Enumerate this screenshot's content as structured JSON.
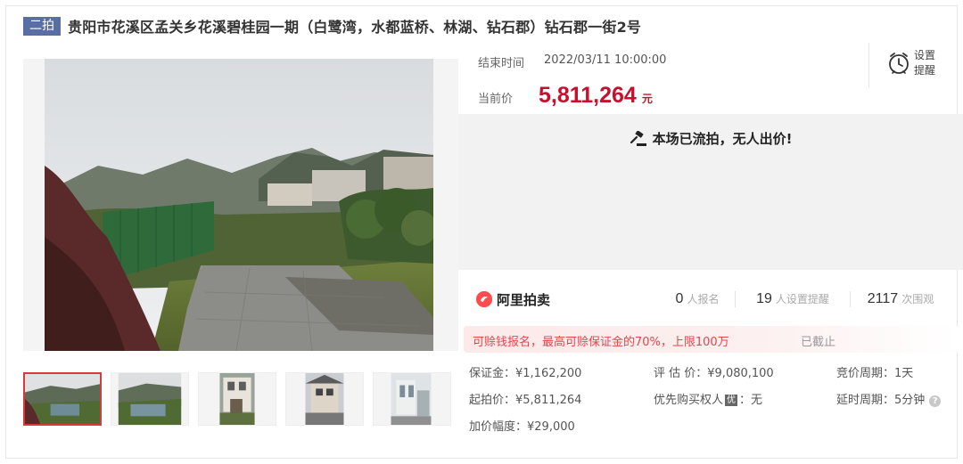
{
  "header": {
    "round_badge": "二拍",
    "title": "贵阳市花溪区孟关乡花溪碧桂园一期（白鹭湾，水都蓝桥、林湖、钻石郡）钻石郡一街2号"
  },
  "auction": {
    "end_time_label": "结束时间",
    "end_time": "2022/03/11 10:00:00",
    "price_label": "当前价",
    "price": "5,811,264",
    "price_unit": "元",
    "remind_label": "设置提醒",
    "status_message": "本场已流拍，无人出价!"
  },
  "stats": {
    "brand": "阿里拍卖",
    "signups": "0",
    "signups_label": "人报名",
    "reminders": "19",
    "reminders_label": "人设置提醒",
    "views": "2117",
    "views_label": "次围观"
  },
  "notice": {
    "text": "可赊钱报名，最高可赊保证金的70%，上限100万",
    "status": "已截止"
  },
  "details": {
    "deposit": "保证金：¥1,162,200",
    "start_price": "起拍价：¥5,811,264",
    "increment": "加价幅度：¥29,000",
    "appraisal": "评 估 价：¥9,080,100",
    "priority_label": "优先购买权人",
    "priority_badge": "优",
    "priority_value": "：无",
    "bid_cycle": "竞价周期：1天",
    "delay_cycle": "延时周期：5分钟",
    "help_glyph": "?"
  },
  "colors": {
    "accent_red": "#c8102e",
    "badge_blue": "#5a6ea6",
    "notice_red": "#e0474c"
  },
  "icons": [
    "alarm-clock-icon",
    "gavel-icon",
    "zoom-icon",
    "help-icon",
    "brand-logo-icon"
  ]
}
